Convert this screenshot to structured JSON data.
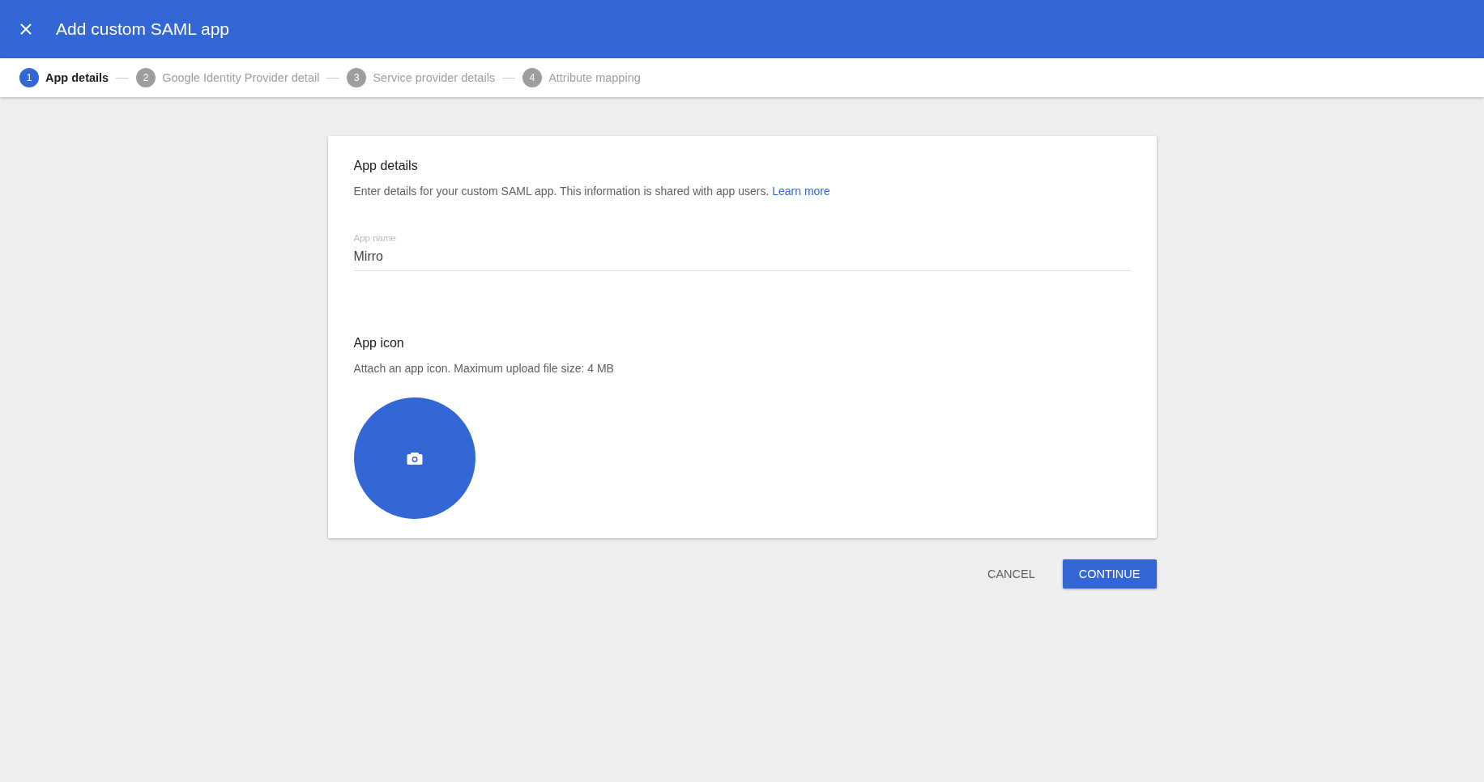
{
  "header": {
    "title": "Add custom SAML app"
  },
  "steps": [
    {
      "number": "1",
      "label": "App details",
      "selected": true
    },
    {
      "number": "2",
      "label": "Google Identity Provider detail",
      "selected": false
    },
    {
      "number": "3",
      "label": "Service provider details",
      "selected": false
    },
    {
      "number": "4",
      "label": "Attribute mapping",
      "selected": false
    }
  ],
  "app_details": {
    "title": "App details",
    "description": "Enter details for your custom SAML app. This information is shared with app users.",
    "link": "Learn more",
    "field_label": "App name",
    "field_value": "Mirro"
  },
  "app_icon": {
    "title": "App icon",
    "description": "Attach an app icon. Maximum upload file size: 4 MB"
  },
  "buttons": {
    "cancel": "CANCEL",
    "continue": "CONTINUE"
  }
}
